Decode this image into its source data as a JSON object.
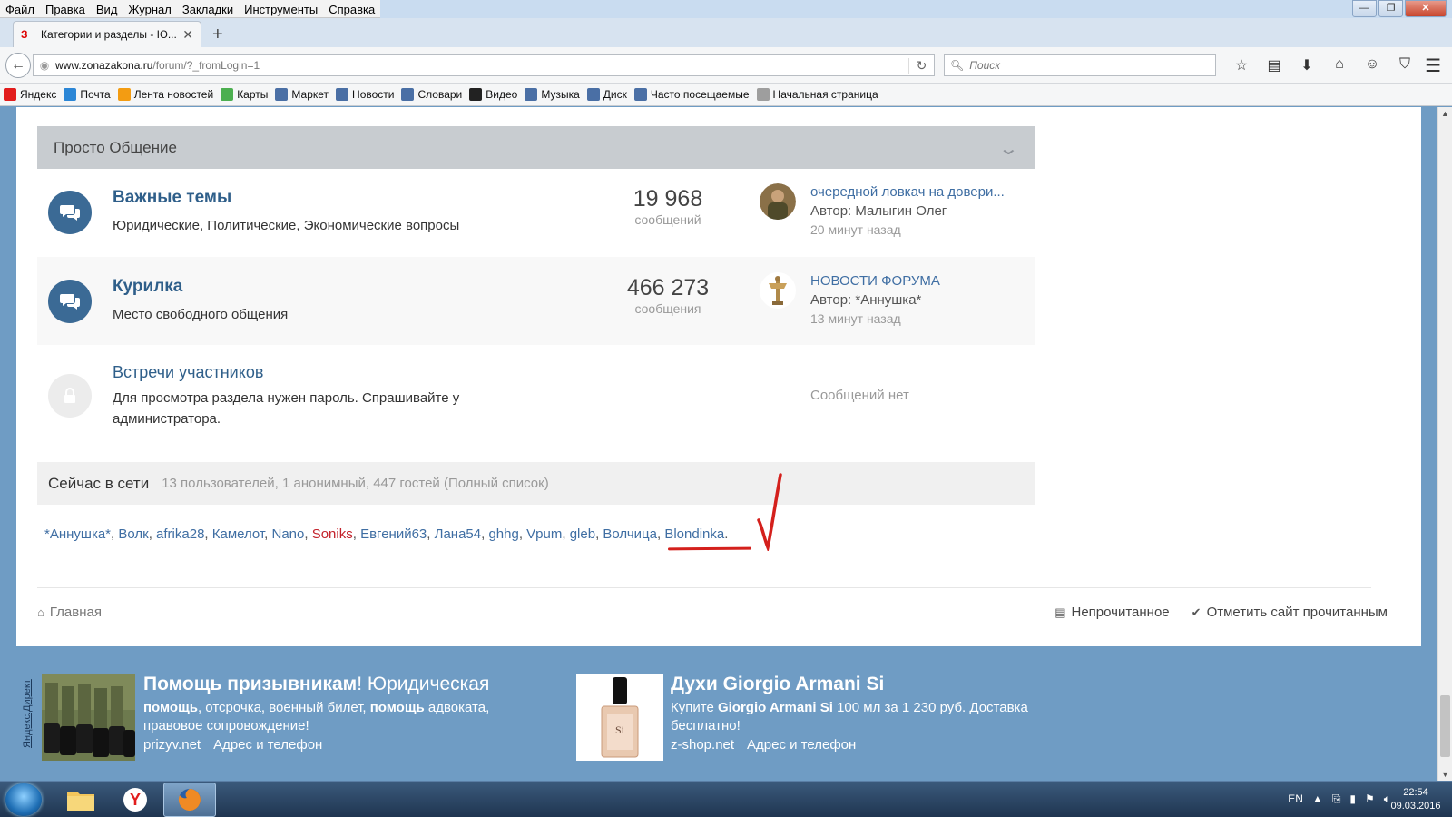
{
  "browser": {
    "menu": [
      "Файл",
      "Правка",
      "Вид",
      "Журнал",
      "Закладки",
      "Инструменты",
      "Справка"
    ],
    "tab_title": "Категории и разделы - Ю...",
    "url_domain": "www.zonazakona.ru",
    "url_path": "/forum/?_fromLogin=1",
    "search_placeholder": "Поиск",
    "bookmarks": [
      {
        "label": "Яндекс",
        "icon": "yandex-icon",
        "color": "#e21d1d"
      },
      {
        "label": "Почта",
        "icon": "mail-icon",
        "color": "#2b86d6"
      },
      {
        "label": "Лента новостей",
        "icon": "rss-icon",
        "color": "#f39c12"
      },
      {
        "label": "Карты",
        "icon": "map-icon",
        "color": "#4caf50"
      },
      {
        "label": "Маркет",
        "icon": "market-icon",
        "color": "#4a6fa5"
      },
      {
        "label": "Новости",
        "icon": "news-icon",
        "color": "#4a6fa5"
      },
      {
        "label": "Словари",
        "icon": "dictionary-icon",
        "color": "#4a6fa5"
      },
      {
        "label": "Видео",
        "icon": "video-icon",
        "color": "#222222"
      },
      {
        "label": "Музыка",
        "icon": "music-icon",
        "color": "#4a6fa5"
      },
      {
        "label": "Диск",
        "icon": "disk-icon",
        "color": "#4a6fa5"
      },
      {
        "label": "Часто посещаемые",
        "icon": "frequent-icon",
        "color": "#4a6fa5"
      },
      {
        "label": "Начальная страница",
        "icon": "home-page-icon",
        "color": "#9e9e9e"
      }
    ]
  },
  "category": {
    "title": "Просто Общение"
  },
  "forums": [
    {
      "name": "Важные темы",
      "description": "Юридические, Политические, Экономические вопросы",
      "count": "19 968",
      "count_label": "сообщений",
      "last_topic": "очередной ловкач на довери...",
      "last_author": "Автор: Малыгин Олег",
      "last_time": "20 минут назад"
    },
    {
      "name": "Курилка",
      "description": "Место свободного общения",
      "count": "466 273",
      "count_label": "сообщения",
      "last_topic": "НОВОСТИ ФОРУМА",
      "last_author": "Автор: *Аннушка*",
      "last_time": "13 минут назад"
    },
    {
      "name": "Встречи участников",
      "description": "Для просмотра раздела нужен пароль. Спрашивайте у администратора.",
      "no_messages": "Сообщений нет"
    }
  ],
  "online": {
    "heading": "Сейчас в сети",
    "stats": "13 пользователей, 1 анонимный, 447 гостей (Полный список)",
    "users": [
      {
        "name": "*Аннушка*",
        "highlight": false
      },
      {
        "name": "Волк",
        "highlight": false
      },
      {
        "name": "afrika28",
        "highlight": false
      },
      {
        "name": "Камелот",
        "highlight": false
      },
      {
        "name": "Nano",
        "highlight": false
      },
      {
        "name": "Soniks",
        "highlight": true
      },
      {
        "name": "Евгений63",
        "highlight": false
      },
      {
        "name": "Лана54",
        "highlight": false
      },
      {
        "name": "ghhg",
        "highlight": false
      },
      {
        "name": "Vpum",
        "highlight": false
      },
      {
        "name": "gleb",
        "highlight": false
      },
      {
        "name": "Волчица",
        "highlight": false
      },
      {
        "name": "Blondinka",
        "highlight": false
      }
    ]
  },
  "footer": {
    "home": "Главная",
    "unread": "Непрочитанное",
    "mark_read": "Отметить сайт прочитанным"
  },
  "ads": {
    "label": "Яндекс.Директ",
    "items": [
      {
        "title_bold": "Помощь призывникам",
        "title_rest": "! Юридическая",
        "desc_html": "<b>помощь</b>, отсрочка, военный билет, <b>помощь</b> адвоката, правовое сопровождение!",
        "domain": "prizyv.net",
        "contacts": "Адрес и телефон"
      },
      {
        "title_bold": "Духи Giorgio Armani Si",
        "title_rest": "",
        "desc_html": "Купите <b>Giorgio Armani Si</b> 100 мл за 1 230 руб. Доставка бесплатно!",
        "domain": "z-shop.net",
        "contacts": "Адрес и телефон"
      }
    ]
  },
  "taskbar": {
    "lang": "EN",
    "time": "22:54",
    "date": "09.03.2016"
  },
  "colors": {
    "link": "#3f6ea3",
    "forum_icon": "#3b6a95",
    "highlight_user": "#c3222b",
    "annotation": "#d4201c",
    "ad_background": "#6f9cc4"
  }
}
